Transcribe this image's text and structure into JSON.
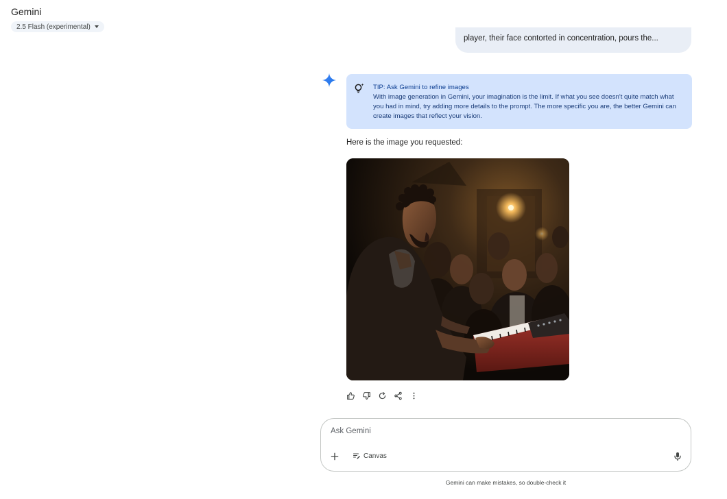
{
  "header": {
    "app_title": "Gemini",
    "model_label": "2.5 Flash (experimental)"
  },
  "conversation": {
    "user_message_excerpt": "player, their face contorted in concentration, pours the...",
    "tip": {
      "title": "TIP: Ask Gemini to refine images",
      "body": "With image generation in Gemini, your imagination is the limit. If what you see doesn't quite match what you had in mind, try adding more details to the prompt. The more specific you are, the better Gemini can create images that reflect your vision."
    },
    "response_text": "Here is the image you requested:"
  },
  "response_actions": [
    {
      "name": "thumbs-up-icon"
    },
    {
      "name": "thumbs-down-icon"
    },
    {
      "name": "regenerate-icon"
    },
    {
      "name": "share-icon"
    },
    {
      "name": "more-vert-icon"
    }
  ],
  "composer": {
    "placeholder": "Ask Gemini",
    "canvas_label": "Canvas"
  },
  "footer": {
    "disclaimer": "Gemini can make mistakes, so double-check it"
  },
  "colors": {
    "tip_background": "#d3e3fd",
    "user_bubble": "#e9eef6",
    "sparkle_blue": "#4285f4"
  }
}
